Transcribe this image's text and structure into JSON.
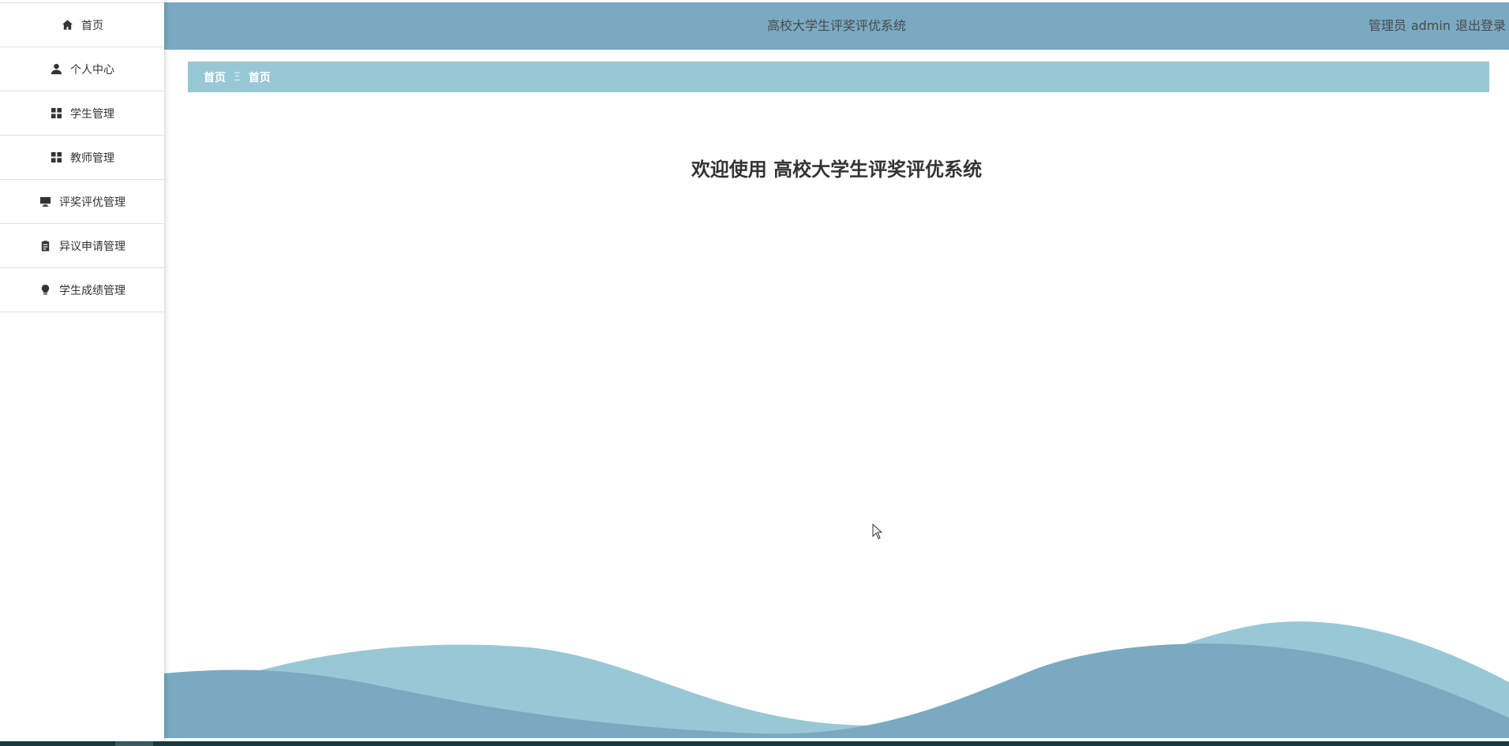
{
  "app": {
    "title": "高校大学生评奖评优系统",
    "role_label": "管理员",
    "username": "admin",
    "logout_label": "退出登录"
  },
  "sidebar": {
    "items": [
      {
        "label": "首页",
        "icon": "home-icon"
      },
      {
        "label": "个人中心",
        "icon": "user-icon"
      },
      {
        "label": "学生管理",
        "icon": "grid-icon"
      },
      {
        "label": "教师管理",
        "icon": "grid-icon"
      },
      {
        "label": "评奖评优管理",
        "icon": "monitor-icon"
      },
      {
        "label": "异议申请管理",
        "icon": "clipboard-icon"
      },
      {
        "label": "学生成绩管理",
        "icon": "lightbulb-icon"
      }
    ]
  },
  "breadcrumb": {
    "items": [
      "首页",
      "首页"
    ],
    "separator": "Ξ"
  },
  "main": {
    "welcome": "欢迎使用 高校大学生评奖评优系统"
  },
  "colors": {
    "header": "#79aac1",
    "breadcrumb": "#98c8d6",
    "wave_light": "#98c8d6",
    "wave_dark": "#79aac1"
  }
}
